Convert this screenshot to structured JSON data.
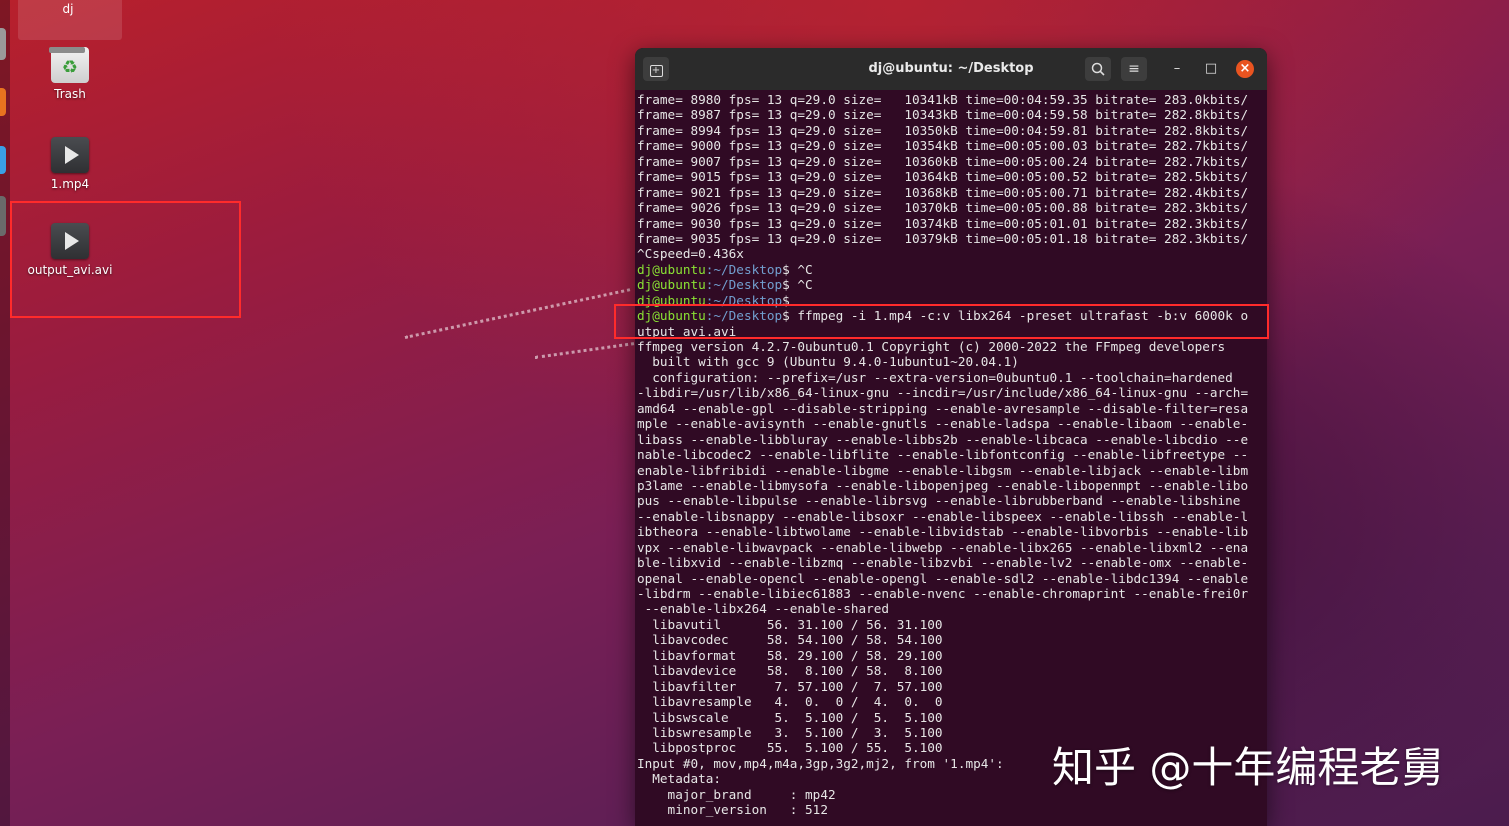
{
  "desktop": {
    "top_tile_label": "dj",
    "icons": [
      {
        "label": "Trash",
        "icon": "trash-icon"
      },
      {
        "label": "1.mp4",
        "icon": "video-file-icon"
      },
      {
        "label": "output_avi.avi",
        "icon": "video-file-icon"
      }
    ]
  },
  "terminal": {
    "title": "dj@ubuntu: ~/Desktop",
    "buttons": {
      "new_tab": "new-tab-icon",
      "search": "search-icon",
      "menu": "hamburger-menu-icon",
      "minimize": "–",
      "maximize": "□",
      "close": "×"
    },
    "prompt_user": "dj@ubuntu",
    "prompt_path": ":~/Desktop",
    "lines": [
      "frame= 8980 fps= 13 q=29.0 size=   10341kB time=00:04:59.35 bitrate= 283.0kbits/",
      "frame= 8987 fps= 13 q=29.0 size=   10343kB time=00:04:59.58 bitrate= 282.8kbits/",
      "frame= 8994 fps= 13 q=29.0 size=   10350kB time=00:04:59.81 bitrate= 282.8kbits/",
      "frame= 9000 fps= 13 q=29.0 size=   10354kB time=00:05:00.03 bitrate= 282.7kbits/",
      "frame= 9007 fps= 13 q=29.0 size=   10360kB time=00:05:00.24 bitrate= 282.7kbits/",
      "frame= 9015 fps= 13 q=29.0 size=   10364kB time=00:05:00.52 bitrate= 282.5kbits/",
      "frame= 9021 fps= 13 q=29.0 size=   10368kB time=00:05:00.71 bitrate= 282.4kbits/",
      "frame= 9026 fps= 13 q=29.0 size=   10370kB time=00:05:00.88 bitrate= 282.3kbits/",
      "frame= 9030 fps= 13 q=29.0 size=   10374kB time=00:05:01.01 bitrate= 282.3kbits/",
      "frame= 9035 fps= 13 q=29.0 size=   10379kB time=00:05:01.18 bitrate= 282.3kbits/",
      "^Cspeed=0.436x",
      {
        "prompt": true,
        "cmd": " ^C"
      },
      {
        "prompt": true,
        "cmd": " ^C"
      },
      {
        "prompt": true,
        "cmd": ""
      },
      {
        "prompt": true,
        "cmd": " ffmpeg -i 1.mp4 -c:v libx264 -preset ultrafast -b:v 6000k o"
      },
      "utput_avi.avi",
      "ffmpeg version 4.2.7-0ubuntu0.1 Copyright (c) 2000-2022 the FFmpeg developers",
      "  built with gcc 9 (Ubuntu 9.4.0-1ubuntu1~20.04.1)",
      "  configuration: --prefix=/usr --extra-version=0ubuntu0.1 --toolchain=hardened",
      "-libdir=/usr/lib/x86_64-linux-gnu --incdir=/usr/include/x86_64-linux-gnu --arch=",
      "amd64 --enable-gpl --disable-stripping --enable-avresample --disable-filter=resa",
      "mple --enable-avisynth --enable-gnutls --enable-ladspa --enable-libaom --enable-",
      "libass --enable-libbluray --enable-libbs2b --enable-libcaca --enable-libcdio --e",
      "nable-libcodec2 --enable-libflite --enable-libfontconfig --enable-libfreetype --",
      "enable-libfribidi --enable-libgme --enable-libgsm --enable-libjack --enable-libm",
      "p3lame --enable-libmysofa --enable-libopenjpeg --enable-libopenmpt --enable-libo",
      "pus --enable-libpulse --enable-librsvg --enable-librubberband --enable-libshine",
      "--enable-libsnappy --enable-libsoxr --enable-libspeex --enable-libssh --enable-l",
      "ibtheora --enable-libtwolame --enable-libvidstab --enable-libvorbis --enable-lib",
      "vpx --enable-libwavpack --enable-libwebp --enable-libx265 --enable-libxml2 --ena",
      "ble-libxvid --enable-libzmq --enable-libzvbi --enable-lv2 --enable-omx --enable-",
      "openal --enable-opencl --enable-opengl --enable-sdl2 --enable-libdc1394 --enable",
      "-libdrm --enable-libiec61883 --enable-nvenc --enable-chromaprint --enable-frei0r",
      " --enable-libx264 --enable-shared",
      "  libavutil      56. 31.100 / 56. 31.100",
      "  libavcodec     58. 54.100 / 58. 54.100",
      "  libavformat    58. 29.100 / 58. 29.100",
      "  libavdevice    58.  8.100 / 58.  8.100",
      "  libavfilter     7. 57.100 /  7. 57.100",
      "  libavresample   4.  0.  0 /  4.  0.  0",
      "  libswscale      5.  5.100 /  5.  5.100",
      "  libswresample   3.  5.100 /  3.  5.100",
      "  libpostproc    55.  5.100 / 55.  5.100",
      "Input #0, mov,mp4,m4a,3gp,3g2,mj2, from '1.mp4':",
      "  Metadata:",
      "    major_brand     : mp42",
      "    minor_version   : 512"
    ]
  },
  "watermark": "知乎 @十年编程老舅",
  "colors": {
    "terminal_bg": "#300a24",
    "prompt_user": "#8ae234",
    "prompt_path": "#729fcf",
    "highlight_box": "#ff2b2b",
    "close_button": "#e95420"
  }
}
